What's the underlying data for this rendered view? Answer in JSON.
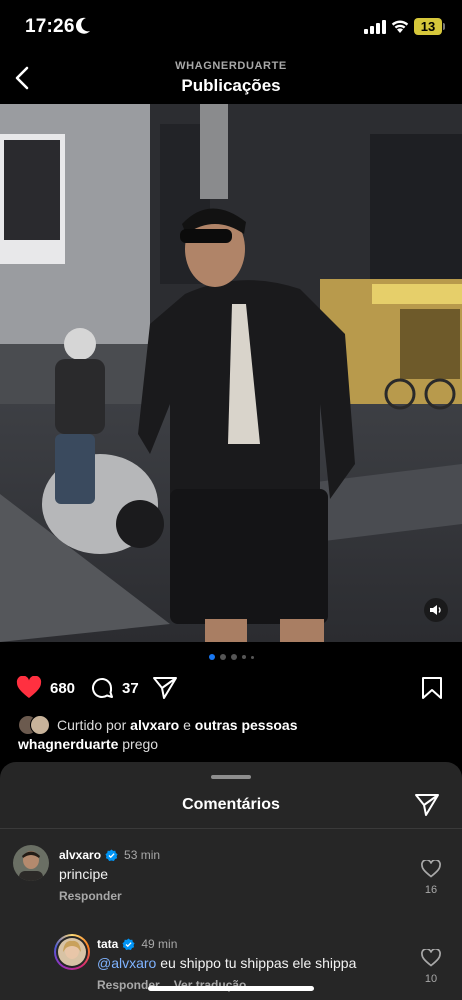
{
  "status_bar": {
    "time": "17:26",
    "battery": "13",
    "icons": [
      "moon-icon",
      "signal-icon",
      "wifi-icon",
      "battery-icon"
    ]
  },
  "header": {
    "username": "WHAGNERDUARTE",
    "title": "Publicações",
    "back_icon": "chevron-left-icon"
  },
  "post": {
    "photo_description": "photo",
    "carousel": {
      "count": 5,
      "active_index": 0
    },
    "likes": "680",
    "comments": "37",
    "liked_by_prefix": "Curtido por",
    "liked_by_user": "alvxaro",
    "liked_by_connector": "e",
    "liked_by_rest": "outras pessoas",
    "caption_user": "whagnerduarte",
    "caption_text": "prego"
  },
  "comments_sheet": {
    "title": "Comentários",
    "comments": [
      {
        "user": "alvxaro",
        "verified": true,
        "time": "53 min",
        "text": "principe",
        "reply_label": "Responder",
        "likes": "16"
      },
      {
        "user": "tata",
        "verified": true,
        "time": "49 min",
        "mention": "@alvxaro",
        "text": "eu shippo tu shippas ele shippa",
        "reply_label": "Responder",
        "translate_label": "Ver tradução",
        "likes": "10"
      }
    ]
  },
  "colors": {
    "background": "#000000",
    "sheet": "#262626",
    "like_red": "#ff3040",
    "verified_blue": "#0095f6",
    "carousel_active": "#1877f2"
  }
}
